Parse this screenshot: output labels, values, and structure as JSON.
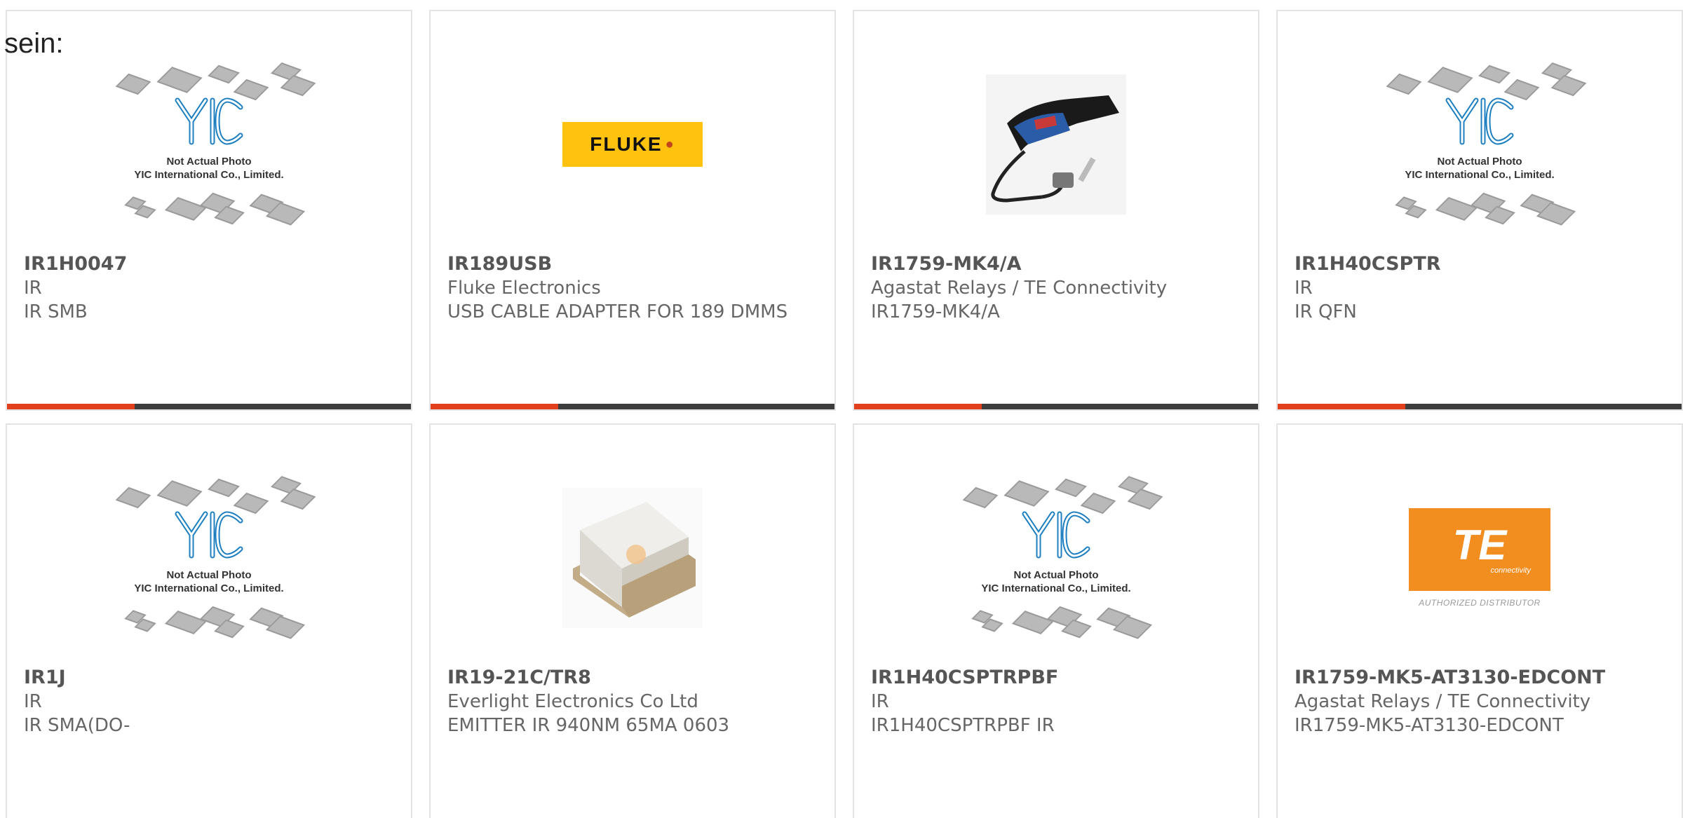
{
  "heading_fragment": "sein:",
  "colors": {
    "accent": "#e2401c",
    "bar_dark": "#3d3d3d",
    "yic_blue": "#1d7fc0",
    "fluke_yellow": "#ffc20e",
    "te_orange": "#f28d1f"
  },
  "placeholder": {
    "line1": "Not Actual Photo",
    "line2": "YIC International Co., Limited."
  },
  "fluke_logo_text": "FLUKE",
  "te_logo": {
    "mark": "TE",
    "sub": "connectivity",
    "authorized": "AUTHORIZED DISTRIBUTOR"
  },
  "products": [
    {
      "part_number": "IR1H0047",
      "manufacturer": "IR",
      "description": "IR SMB",
      "image": "yic-placeholder"
    },
    {
      "part_number": "IR189USB",
      "manufacturer": "Fluke Electronics",
      "description": "USB CABLE ADAPTER FOR 189 DMMS",
      "image": "fluke-logo"
    },
    {
      "part_number": "IR1759-MK4/A",
      "manufacturer": "Agastat Relays / TE Connectivity",
      "description": "IR1759-MK4/A",
      "image": "ir-probe-photo"
    },
    {
      "part_number": "IR1H40CSPTR",
      "manufacturer": "IR",
      "description": "IR QFN",
      "image": "yic-placeholder"
    },
    {
      "part_number": "IR1J",
      "manufacturer": "IR",
      "description": "IR SMA(DO-",
      "image": "yic-placeholder"
    },
    {
      "part_number": "IR19-21C/TR8",
      "manufacturer": "Everlight Electronics Co Ltd",
      "description": "EMITTER IR 940NM 65MA 0603",
      "image": "smd-led-photo"
    },
    {
      "part_number": "IR1H40CSPTRPBF",
      "manufacturer": "IR",
      "description": "IR1H40CSPTRPBF IR",
      "image": "yic-placeholder"
    },
    {
      "part_number": "IR1759-MK5-AT3130-EDCONT",
      "manufacturer": "Agastat Relays / TE Connectivity",
      "description": "IR1759-MK5-AT3130-EDCONT",
      "image": "te-logo"
    }
  ]
}
